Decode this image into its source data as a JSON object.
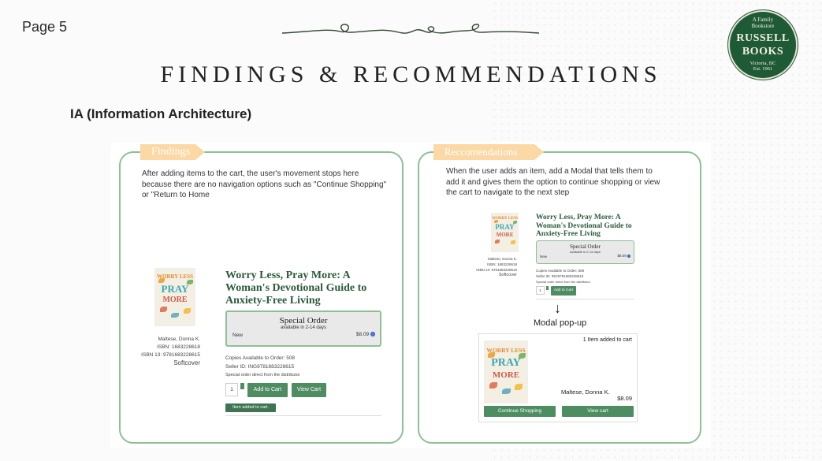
{
  "page": {
    "number_label": "Page 5"
  },
  "header": {
    "title": "FINDINGS & RECOMMENDATIONS",
    "subheading": "IA (Information Architecture)"
  },
  "logo": {
    "line1": "A Family",
    "line1b": "Bookstore",
    "line2": "RUSSELL",
    "line3": "BOOKS",
    "line4": "Victoria, BC",
    "line5": "Est. 1961"
  },
  "findings": {
    "tag": "Findings",
    "description_lines": [
      "After adding items to the cart, the user's movement stops here",
      "because there are no navigation options such as \"Continue Shopping\"",
      "or \"Return to Home"
    ],
    "book": {
      "cover_top": "WORRY LESS",
      "cover_mid": "PRAY",
      "cover_bot": "MORE",
      "author": "Maltese, Donna K.",
      "isbn": "ISBN: 1683228618",
      "isbn13": "ISBN 13: 9781683228615",
      "format": "Softcover",
      "title_lines": [
        "Worry Less, Pray More: A",
        "Woman's Devotional Guide to",
        "Anxiety-Free Living"
      ],
      "order_title": "Special Order",
      "order_sub": "available in 2-14 days",
      "condition": "New",
      "price": "$8.09",
      "copies": "Copies Available to Order: 508",
      "seller": "Seller ID: ING9781683228615",
      "note": "Special order direct from the distributor",
      "qty": "1",
      "add_label": "Add to Cart",
      "view_label": "View Cart",
      "added_label": "Item added to cart."
    }
  },
  "recommendations": {
    "tag": "Reccomendations",
    "description_lines": [
      "When the user adds an item, add a Modal that tells them to",
      "add it and gives them the option to continue shopping or view",
      "the cart to navigate to the next step"
    ],
    "book": {
      "author": "Maltese, Donna K.",
      "isbn": "ISBN: 1683228618",
      "isbn13": "ISBN 13: 9781683228615",
      "format": "Softcover",
      "title_lines": [
        "Worry Less, Pray More: A",
        "Woman's Devotional Guide to",
        "Anxiety-Free Living"
      ],
      "order_title": "Special Order",
      "order_sub": "available in 2-14 days",
      "condition": "New",
      "price": "$8.09",
      "copies": "Copies Available to Order: 508",
      "seller": "Seller ID: ING9781683228615",
      "note": "Special order direct from the distributor",
      "qty": "1",
      "add_label": "Add to Cart"
    },
    "arrow": "↓",
    "modal_label": "Modal pop-up",
    "modal": {
      "header": "1 Item added to cart",
      "author": "Maltese, Donna K.",
      "price": "$8.09",
      "continue_label": "Continue Shopping",
      "view_label": "View cart"
    }
  },
  "colors": {
    "accent_green": "#4e8c61",
    "panel_border": "#8fbf95",
    "tag_orange": "#fbd8a4",
    "logo_green": "#1f5a36"
  }
}
